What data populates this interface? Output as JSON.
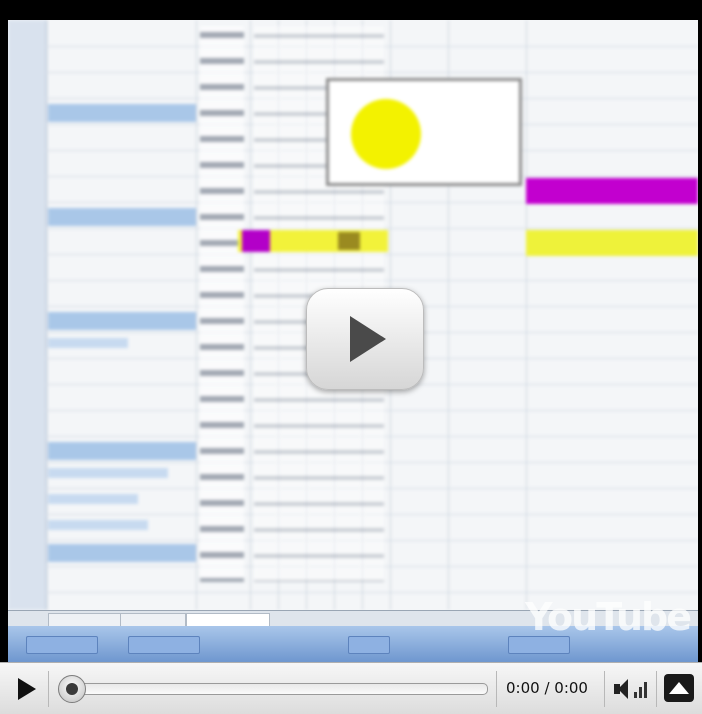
{
  "player": {
    "current_time": "0:00",
    "separator": "/",
    "duration": "0:00",
    "time_display": "0:00 / 0:00",
    "progress": 0,
    "watermark": "YouTube"
  },
  "icons": {
    "big_play": "play-icon",
    "play": "play-icon",
    "volume": "volume-icon",
    "menu": "eject-up-icon"
  },
  "colors": {
    "highlight_magenta": "#c200cf",
    "highlight_yellow": "#eef23a",
    "callout_circle": "#f3f200",
    "control_bar": "#e9e9e9"
  }
}
